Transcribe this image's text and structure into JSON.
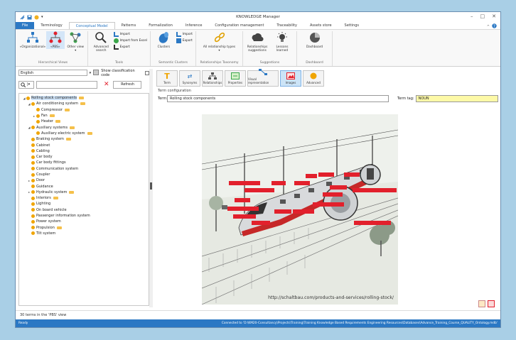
{
  "window": {
    "title": "KNOWLEDGE Manager"
  },
  "menu": {
    "tabs": [
      "File",
      "Terminology",
      "Conceptual Model",
      "Patterns",
      "Formalization",
      "Inference",
      "Configuration management",
      "Traceability",
      "Assets store",
      "Settings"
    ],
    "active": "Conceptual Model"
  },
  "ribbon": {
    "groups": [
      {
        "label": "Hierarchical Views",
        "buttons": [
          "«Organizational»",
          "«PBS»",
          "Other view ▾"
        ]
      },
      {
        "label": "Tools",
        "buttons": [
          "Advanced search"
        ],
        "small": [
          "Import",
          "Import from Excel",
          "Export"
        ]
      },
      {
        "label": "Semantic Clusters",
        "buttons": [
          "Clusters"
        ],
        "small": [
          "Import",
          "Export"
        ]
      },
      {
        "label": "Relationships Taxonomy",
        "buttons": [
          "All relationship types ▾"
        ]
      },
      {
        "label": "Suggestions",
        "buttons": [
          "Relationships suggestions",
          "Lessons learned"
        ]
      },
      {
        "label": "Dashboard",
        "buttons": [
          "Dashboard"
        ]
      }
    ]
  },
  "left": {
    "language": "English",
    "show_classification": "Show classification code",
    "refresh": "Refresh",
    "tree": [
      {
        "label": "Rolling stock components",
        "level": 0,
        "toggle": "◢",
        "folder": true,
        "selected": true
      },
      {
        "label": "Air conditioning system",
        "level": 1,
        "toggle": "◢",
        "folder": true
      },
      {
        "label": "Compressor",
        "level": 2,
        "toggle": "",
        "folder": true
      },
      {
        "label": "Fan",
        "level": 2,
        "toggle": "▸",
        "folder": true
      },
      {
        "label": "Heater",
        "level": 2,
        "toggle": "",
        "folder": true
      },
      {
        "label": "Auxiliary systems",
        "level": 1,
        "toggle": "◢",
        "folder": true
      },
      {
        "label": "Auxiliary electric system",
        "level": 2,
        "toggle": "",
        "folder": true
      },
      {
        "label": "Braking system",
        "level": 1,
        "toggle": "",
        "folder": true
      },
      {
        "label": "Cabinet",
        "level": 1,
        "toggle": "",
        "folder": false
      },
      {
        "label": "Cabling",
        "level": 1,
        "toggle": "",
        "folder": false
      },
      {
        "label": "Car body",
        "level": 1,
        "toggle": "",
        "folder": false
      },
      {
        "label": "Car body fittings",
        "level": 1,
        "toggle": "",
        "folder": false
      },
      {
        "label": "Communication system",
        "level": 1,
        "toggle": "",
        "folder": false
      },
      {
        "label": "Coupler",
        "level": 1,
        "toggle": "",
        "folder": false
      },
      {
        "label": "Door",
        "level": 1,
        "toggle": "▸",
        "folder": false
      },
      {
        "label": "Guidance",
        "level": 1,
        "toggle": "",
        "folder": false
      },
      {
        "label": "Hydraulic system",
        "level": 1,
        "toggle": "▸",
        "folder": true
      },
      {
        "label": "Interiors",
        "level": 1,
        "toggle": "",
        "folder": true
      },
      {
        "label": "Lighting",
        "level": 1,
        "toggle": "",
        "folder": false
      },
      {
        "label": "On board vehicle",
        "level": 1,
        "toggle": "",
        "folder": false
      },
      {
        "label": "Passenger information system",
        "level": 1,
        "toggle": "",
        "folder": false
      },
      {
        "label": "Power system",
        "level": 1,
        "toggle": "",
        "folder": false
      },
      {
        "label": "Propulsion",
        "level": 1,
        "toggle": "",
        "folder": true
      },
      {
        "label": "Tilt system",
        "level": 1,
        "toggle": "",
        "folder": false
      }
    ],
    "count": "30 terms in the 'PBS' view"
  },
  "right": {
    "tools": [
      "Term",
      "Synonyms",
      "Relationships",
      "Properties",
      "Visual representation",
      "Images",
      "Advanced"
    ],
    "selected_tool": "Images",
    "section": "Term configuration",
    "term_label": "Term:",
    "term_value": "Rolling stock components",
    "tag_label": "Term tag:",
    "tag_value": "NOUN",
    "image_url": "http://schaltbau.com/products-and-services/rolling-stock/",
    "image_labels": [
      "Data Communications",
      "Drivers Desk and Cab",
      "Lighting",
      "Pantographs for Rolling Stock",
      "Lighting Systems",
      "Contactors",
      "Connectors",
      "Auxiliary Power",
      "Coupling",
      "PWM 1",
      "Ventilation",
      "Rail Interiors",
      "Security",
      "Rail Inter Systems",
      "Rail Electric",
      "Door Interfaces",
      "Passenger Information",
      "Sensors/Control Stack",
      "Ramp control box"
    ]
  },
  "status": {
    "left": "Ready",
    "path": "Connected to 'D:\\KM20-Consultancy\\Projects\\Training\\Training Knowledge Based Requirements Engineering Resources\\Databases\\Advance_Training_Course_QUALITY_Ontology.mdb'"
  },
  "colors": {
    "accent": "#2b78c4",
    "tag_bg": "#fdf9a7",
    "label_red": "#e2202c"
  }
}
